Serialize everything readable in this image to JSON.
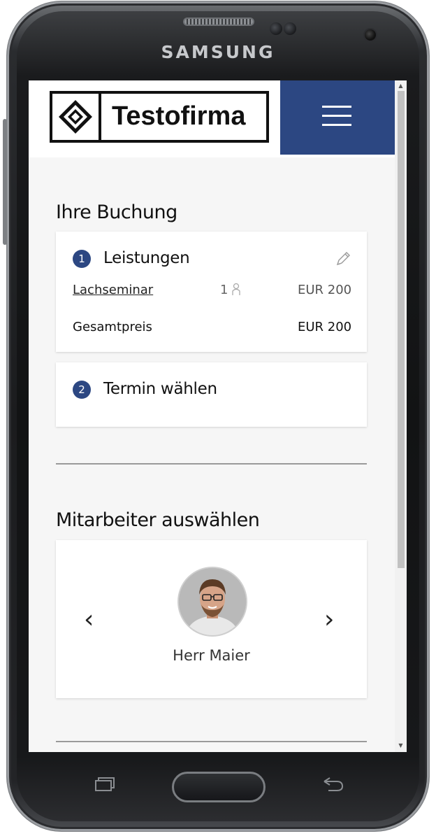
{
  "device": {
    "brand": "SAMSUNG"
  },
  "header": {
    "logo_text": "Testofirma"
  },
  "booking": {
    "title": "Ihre Buchung",
    "step1": {
      "number": "1",
      "title": "Leistungen",
      "item_name": "Lachseminar",
      "item_qty": "1",
      "item_price": "EUR 200",
      "total_label": "Gesamtpreis",
      "total_value": "EUR 200"
    },
    "step2": {
      "number": "2",
      "title": "Termin wählen"
    }
  },
  "staff": {
    "title": "Mitarbeiter auswählen",
    "current_name": "Herr Maier",
    "prev_arrow": "‹",
    "next_arrow": "›"
  },
  "colors": {
    "accent": "#2c4782",
    "background": "#f6f6f6"
  }
}
